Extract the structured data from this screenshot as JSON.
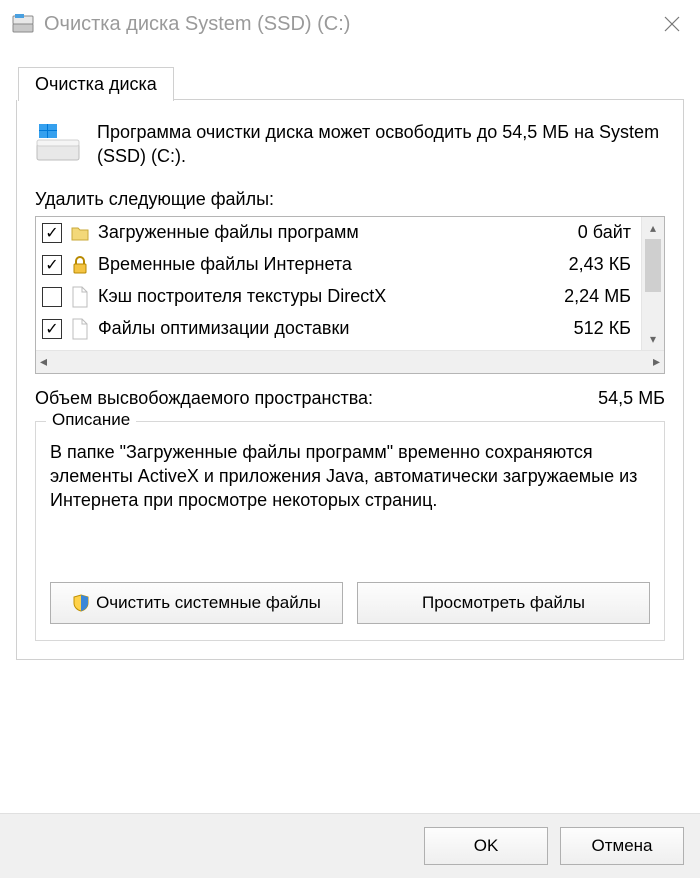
{
  "window": {
    "title": "Очистка диска System (SSD) (C:)"
  },
  "tab": {
    "label": "Очистка диска"
  },
  "intro": {
    "text": "Программа очистки диска может освободить до 54,5 МБ на System (SSD) (C:)."
  },
  "list": {
    "label": "Удалить следующие файлы:",
    "items": [
      {
        "checked": true,
        "icon": "folder",
        "name": "Загруженные файлы программ",
        "size": "0 байт"
      },
      {
        "checked": true,
        "icon": "lock",
        "name": "Временные файлы Интернета",
        "size": "2,43 КБ"
      },
      {
        "checked": false,
        "icon": "file",
        "name": "Кэш построителя текстуры DirectX",
        "size": "2,24 МБ"
      },
      {
        "checked": true,
        "icon": "file",
        "name": "Файлы оптимизации доставки",
        "size": "512 КБ"
      }
    ]
  },
  "space": {
    "label": "Объем высвобождаемого пространства:",
    "value": "54,5 МБ"
  },
  "description": {
    "legend": "Описание",
    "text": "В папке \"Загруженные файлы программ\" временно сохраняются элементы ActiveX и приложения Java, автоматически загружаемые из Интернета при просмотре некоторых страниц."
  },
  "buttons": {
    "clean_system": "Очистить системные файлы",
    "view_files": "Просмотреть файлы",
    "ok": "OK",
    "cancel": "Отмена"
  }
}
